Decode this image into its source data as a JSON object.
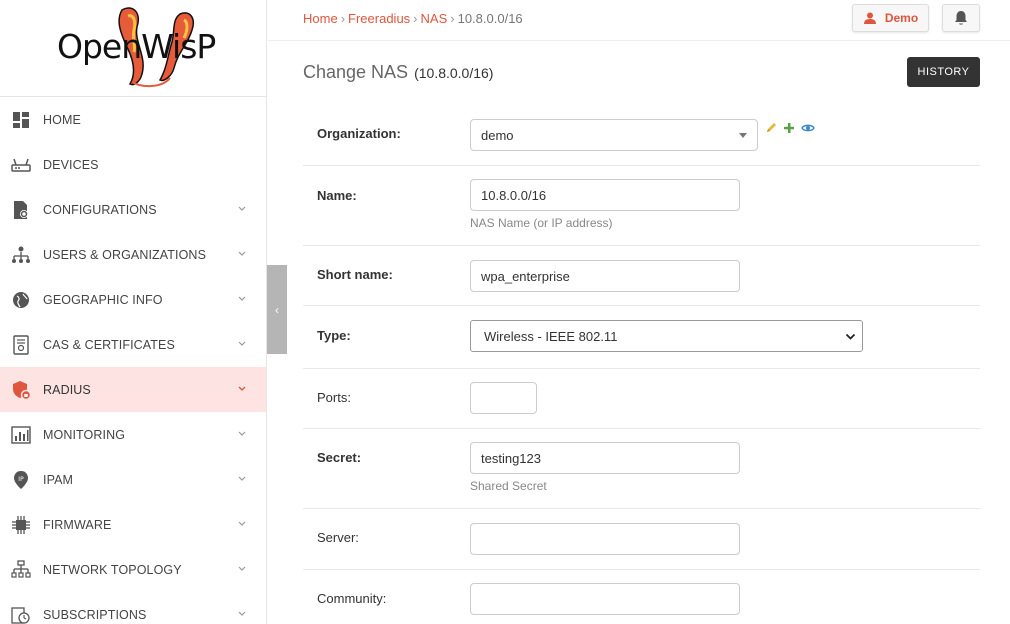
{
  "logo": {
    "text": "OpenWisP"
  },
  "sidebar": {
    "items": [
      {
        "label": "HOME",
        "icon": "home-icon",
        "chevron": false,
        "active": false
      },
      {
        "label": "DEVICES",
        "icon": "router-icon",
        "chevron": false,
        "active": false
      },
      {
        "label": "CONFIGURATIONS",
        "icon": "file-gear-icon",
        "chevron": true,
        "active": false
      },
      {
        "label": "USERS & ORGANIZATIONS",
        "icon": "org-tree-icon",
        "chevron": true,
        "active": false
      },
      {
        "label": "GEOGRAPHIC INFO",
        "icon": "globe-icon",
        "chevron": true,
        "active": false
      },
      {
        "label": "CAS & CERTIFICATES",
        "icon": "certificate-icon",
        "chevron": true,
        "active": false
      },
      {
        "label": "RADIUS",
        "icon": "shield-lock-icon",
        "chevron": true,
        "active": true
      },
      {
        "label": "MONITORING",
        "icon": "bar-chart-icon",
        "chevron": true,
        "active": false
      },
      {
        "label": "IPAM",
        "icon": "location-pin-icon",
        "chevron": true,
        "active": false
      },
      {
        "label": "FIRMWARE",
        "icon": "chip-icon",
        "chevron": true,
        "active": false
      },
      {
        "label": "NETWORK TOPOLOGY",
        "icon": "network-icon",
        "chevron": true,
        "active": false
      },
      {
        "label": "SUBSCRIPTIONS",
        "icon": "bell-clock-icon",
        "chevron": true,
        "active": false
      }
    ],
    "collapse_glyph": "‹"
  },
  "header": {
    "breadcrumb": [
      {
        "label": "Home",
        "link": true
      },
      {
        "label": "Freeradius",
        "link": true
      },
      {
        "label": "NAS",
        "link": true
      },
      {
        "label": "10.8.0.0/16",
        "link": false
      }
    ],
    "separator": "›",
    "user_label": "Demo"
  },
  "page": {
    "title": "Change NAS",
    "object": "(10.8.0.0/16)",
    "history_label": "HISTORY"
  },
  "form": {
    "organization": {
      "label": "Organization:",
      "value": "demo"
    },
    "name": {
      "label": "Name:",
      "value": "10.8.0.0/16",
      "help": "NAS Name (or IP address)"
    },
    "short_name": {
      "label": "Short name:",
      "value": "wpa_enterprise"
    },
    "type": {
      "label": "Type:",
      "value": "Wireless - IEEE 802.11"
    },
    "ports": {
      "label": "Ports:",
      "value": ""
    },
    "secret": {
      "label": "Secret:",
      "value": "testing123",
      "help": "Shared Secret"
    },
    "server": {
      "label": "Server:",
      "value": ""
    },
    "community": {
      "label": "Community:",
      "value": ""
    }
  },
  "colors": {
    "accent": "#e0563d",
    "active_bg": "#fde4e2",
    "dark_button": "#333333"
  }
}
